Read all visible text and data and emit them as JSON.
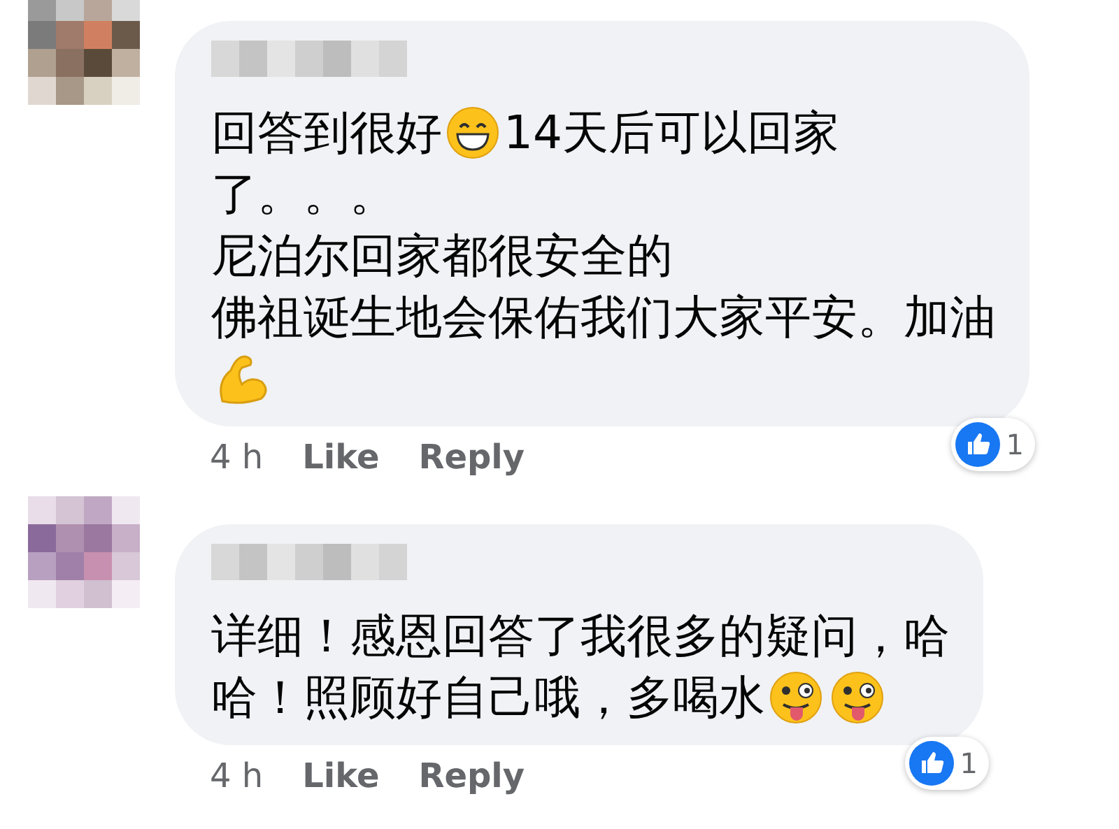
{
  "comments": [
    {
      "lines": [
        [
          {
            "kind": "text",
            "text": "回答到很好"
          },
          {
            "kind": "grin"
          },
          {
            "kind": "text",
            "text": "14天后可以回家"
          }
        ],
        [
          {
            "kind": "text",
            "text": "了。。。"
          }
        ],
        [
          {
            "kind": "text",
            "text": "尼泊尔回家都很安全的"
          }
        ],
        [
          {
            "kind": "text",
            "text": "佛祖诞生地会保佑我们大家平安。加油"
          }
        ],
        [
          {
            "kind": "flex"
          }
        ]
      ],
      "time": "4 h",
      "like": "Like",
      "reply": "Reply",
      "reaction_count": "1"
    },
    {
      "lines": [
        [
          {
            "kind": "text",
            "text": "详细！感恩回答了我很多的疑问，哈"
          }
        ],
        [
          {
            "kind": "text",
            "text": "哈！照顾好自己哦，多喝水"
          },
          {
            "kind": "tongue"
          },
          {
            "kind": "tongue"
          }
        ]
      ],
      "time": "4 h",
      "like": "Like",
      "reply": "Reply",
      "reaction_count": "1"
    }
  ]
}
